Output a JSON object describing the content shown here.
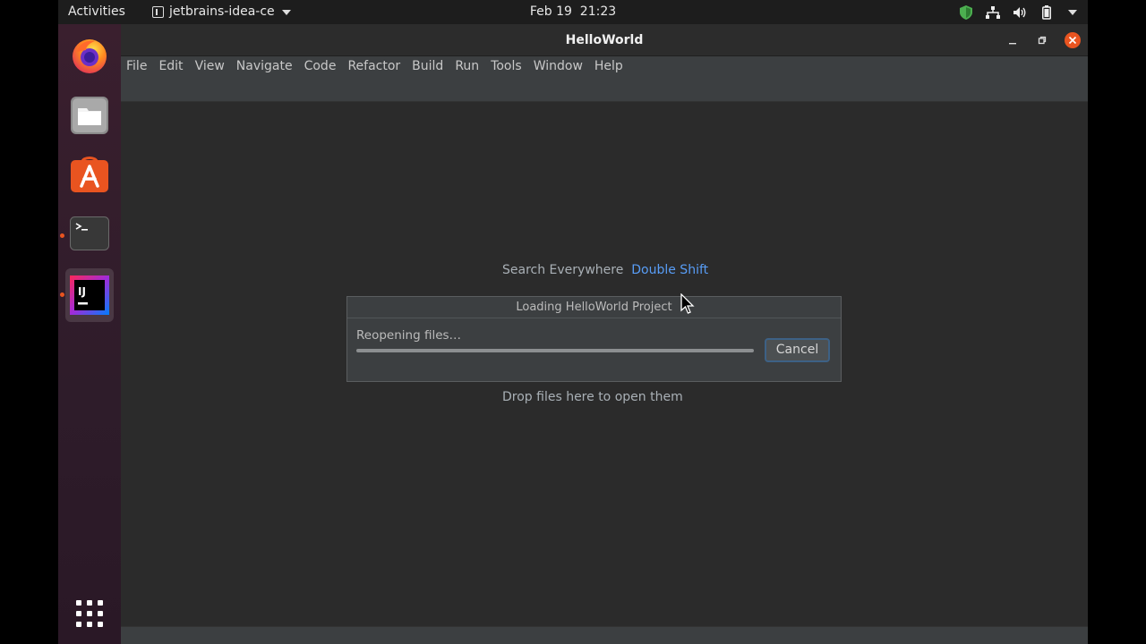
{
  "topbar": {
    "activities": "Activities",
    "app_name": "jetbrains-idea-ce",
    "date": "Feb 19",
    "time": "21:23",
    "tray_icons": [
      "shield-icon",
      "network-icon",
      "volume-icon",
      "battery-icon",
      "system-menu-caret-icon"
    ]
  },
  "dock": {
    "apps": [
      {
        "name": "Firefox",
        "icon": "firefox-icon"
      },
      {
        "name": "Files",
        "icon": "files-icon"
      },
      {
        "name": "Ubuntu Software",
        "icon": "software-store-icon"
      },
      {
        "name": "Terminal",
        "icon": "terminal-icon",
        "running": true
      },
      {
        "name": "IntelliJ IDEA",
        "icon": "intellij-icon",
        "label": "IJ",
        "running": true,
        "active": true
      }
    ],
    "show_apps_icon": "app-grid-icon"
  },
  "window": {
    "title": "HelloWorld",
    "menu": [
      "File",
      "Edit",
      "View",
      "Navigate",
      "Code",
      "Refactor",
      "Build",
      "Run",
      "Tools",
      "Window",
      "Help"
    ]
  },
  "editor": {
    "search_hint": "Search Everywhere",
    "search_shortcut": "Double Shift",
    "drop_hint": "Drop files here to open them"
  },
  "dialog": {
    "title": "Loading HelloWorld Project",
    "message": "Reopening files…",
    "progress": 1.0,
    "cancel_label": "Cancel"
  },
  "colors": {
    "accent": "#589df6",
    "ubuntu_orange": "#e95420",
    "close_button": "#e95420"
  }
}
